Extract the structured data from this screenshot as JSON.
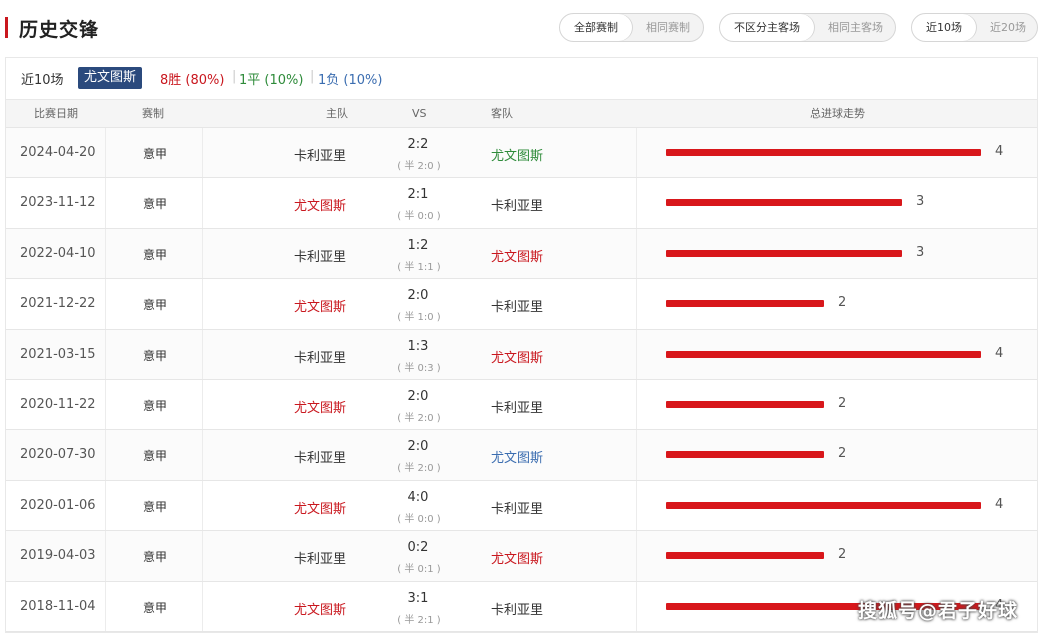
{
  "header": {
    "title": "历史交锋",
    "filters": [
      {
        "options": [
          {
            "label": "全部赛制",
            "active": true
          },
          {
            "label": "相同赛制",
            "active": false
          }
        ]
      },
      {
        "options": [
          {
            "label": "不区分主客场",
            "active": true
          },
          {
            "label": "相同主客场",
            "active": false
          }
        ]
      },
      {
        "options": [
          {
            "label": "近10场",
            "active": true
          },
          {
            "label": "近20场",
            "active": false
          }
        ]
      }
    ]
  },
  "summary": {
    "label": "近10场",
    "team": "尤文图斯",
    "win": "8胜 (80%)",
    "draw": "1平 (10%)",
    "loss": "1负 (10%)",
    "sep": "|"
  },
  "table": {
    "headers": {
      "date": "比赛日期",
      "competition": "赛制",
      "home": "主队",
      "vs": "VS",
      "away": "客队",
      "trend": "总进球走势"
    },
    "max_goals": 4,
    "rows": [
      {
        "date": "2024-04-20",
        "competition": "意甲",
        "home": "卡利亚里",
        "home_color": "dark",
        "score": "2:2",
        "half": "( 半 2:0 )",
        "away": "尤文图斯",
        "away_color": "green",
        "total_goals": 4
      },
      {
        "date": "2023-11-12",
        "competition": "意甲",
        "home": "尤文图斯",
        "home_color": "red",
        "score": "2:1",
        "half": "( 半 0:0 )",
        "away": "卡利亚里",
        "away_color": "dark",
        "total_goals": 3
      },
      {
        "date": "2022-04-10",
        "competition": "意甲",
        "home": "卡利亚里",
        "home_color": "dark",
        "score": "1:2",
        "half": "( 半 1:1 )",
        "away": "尤文图斯",
        "away_color": "red",
        "total_goals": 3
      },
      {
        "date": "2021-12-22",
        "competition": "意甲",
        "home": "尤文图斯",
        "home_color": "red",
        "score": "2:0",
        "half": "( 半 1:0 )",
        "away": "卡利亚里",
        "away_color": "dark",
        "total_goals": 2
      },
      {
        "date": "2021-03-15",
        "competition": "意甲",
        "home": "卡利亚里",
        "home_color": "dark",
        "score": "1:3",
        "half": "( 半 0:3 )",
        "away": "尤文图斯",
        "away_color": "red",
        "total_goals": 4
      },
      {
        "date": "2020-11-22",
        "competition": "意甲",
        "home": "尤文图斯",
        "home_color": "red",
        "score": "2:0",
        "half": "( 半 2:0 )",
        "away": "卡利亚里",
        "away_color": "dark",
        "total_goals": 2
      },
      {
        "date": "2020-07-30",
        "competition": "意甲",
        "home": "卡利亚里",
        "home_color": "dark",
        "score": "2:0",
        "half": "( 半 2:0 )",
        "away": "尤文图斯",
        "away_color": "blue",
        "total_goals": 2
      },
      {
        "date": "2020-01-06",
        "competition": "意甲",
        "home": "尤文图斯",
        "home_color": "red",
        "score": "4:0",
        "half": "( 半 0:0 )",
        "away": "卡利亚里",
        "away_color": "dark",
        "total_goals": 4
      },
      {
        "date": "2019-04-03",
        "competition": "意甲",
        "home": "卡利亚里",
        "home_color": "dark",
        "score": "0:2",
        "half": "( 半 0:1 )",
        "away": "尤文图斯",
        "away_color": "red",
        "total_goals": 2
      },
      {
        "date": "2018-11-04",
        "competition": "意甲",
        "home": "尤文图斯",
        "home_color": "red",
        "score": "3:1",
        "half": "( 半 2:1 )",
        "away": "卡利亚里",
        "away_color": "dark",
        "total_goals": 4
      }
    ]
  },
  "watermark": "搜狐号@君子好球",
  "colors": {
    "accent_red": "#c9171e",
    "bar_red": "#d8171b",
    "win_green": "#2e8b3a",
    "loss_blue": "#3b6db0",
    "badge_navy": "#2b4a7d"
  }
}
